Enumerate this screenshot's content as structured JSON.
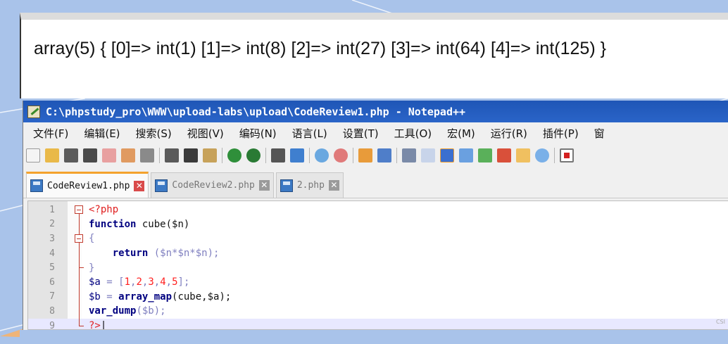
{
  "browser": {
    "output": "array(5) { [0]=> int(1) [1]=> int(8) [2]=> int(27) [3]=> int(64) [4]=> int(125) }"
  },
  "window": {
    "title": "C:\\phpstudy_pro\\WWW\\upload-labs\\upload\\CodeReview1.php - Notepad++"
  },
  "menu": [
    "文件(F)",
    "编辑(E)",
    "搜索(S)",
    "视图(V)",
    "编码(N)",
    "语言(L)",
    "设置(T)",
    "工具(O)",
    "宏(M)",
    "运行(R)",
    "插件(P)",
    "窗"
  ],
  "tabs": [
    {
      "label": "CodeReview1.php",
      "active": true
    },
    {
      "label": "CodeReview2.php",
      "active": false
    },
    {
      "label": "2.php",
      "active": false
    }
  ],
  "code": {
    "line_numbers": [
      "1",
      "2",
      "3",
      "4",
      "5",
      "6",
      "7",
      "8",
      "9"
    ],
    "l1": "<?php",
    "l2_kw": "function",
    "l2_rest": " cube($n)",
    "l3": "{",
    "l4_kw": "return",
    "l4_rest": " ($n*$n*$n);",
    "l5": "}",
    "l6_var": "$a",
    "l6_op": " = [",
    "l6_n1": "1",
    "l6_n2": "2",
    "l6_n3": "3",
    "l6_n4": "4",
    "l6_n5": "5",
    "l6_end": "];",
    "l7_var": "$b",
    "l7_op": " = ",
    "l7_fn": "array_map",
    "l7_rest": "(cube,$a);",
    "l8_fn": "var_dump",
    "l8_rest": "($b);",
    "l9": "?>"
  },
  "watermark": "CSI",
  "colors": {
    "background": "#a9c3ea",
    "titlebar": "#2a64c8",
    "active_tab_accent": "#f4a22d"
  }
}
